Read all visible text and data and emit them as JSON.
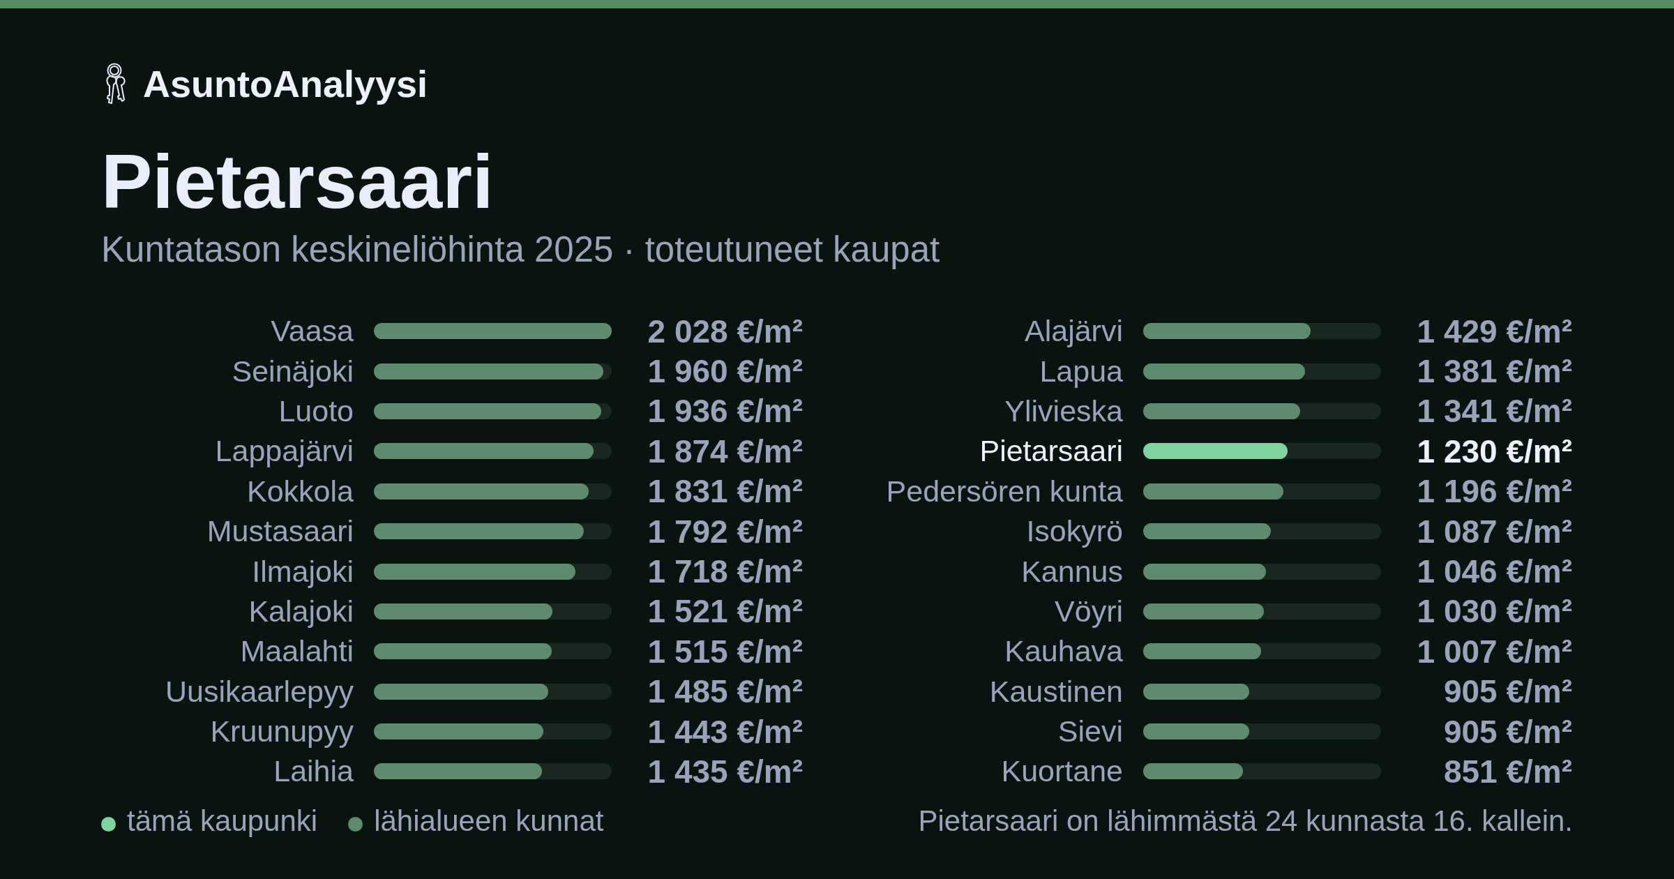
{
  "brand": {
    "name": "AsuntoAnalyysi"
  },
  "title": "Pietarsaari",
  "subtitle": "Kuntatason keskineliöhinta 2025 · toteutuneet kaupat",
  "municipalities": [
    {
      "name": "Vaasa",
      "price": "2 028 €/m²",
      "level": 1.0,
      "current": false
    },
    {
      "name": "Seinäjoki",
      "price": "1 960 €/m²",
      "level": 0.966,
      "current": false
    },
    {
      "name": "Luoto",
      "price": "1 936 €/m²",
      "level": 0.955,
      "current": false
    },
    {
      "name": "Lappajärvi",
      "price": "1 874 €/m²",
      "level": 0.924,
      "current": false
    },
    {
      "name": "Kokkola",
      "price": "1 831 €/m²",
      "level": 0.903,
      "current": false
    },
    {
      "name": "Mustasaari",
      "price": "1 792 €/m²",
      "level": 0.884,
      "current": false
    },
    {
      "name": "Ilmajoki",
      "price": "1 718 €/m²",
      "level": 0.847,
      "current": false
    },
    {
      "name": "Kalajoki",
      "price": "1 521 €/m²",
      "level": 0.75,
      "current": false
    },
    {
      "name": "Maalahti",
      "price": "1 515 €/m²",
      "level": 0.747,
      "current": false
    },
    {
      "name": "Uusikaarlepyy",
      "price": "1 485 €/m²",
      "level": 0.732,
      "current": false
    },
    {
      "name": "Kruunupyy",
      "price": "1 443 €/m²",
      "level": 0.712,
      "current": false
    },
    {
      "name": "Laihia",
      "price": "1 435 €/m²",
      "level": 0.708,
      "current": false
    },
    {
      "name": "Alajärvi",
      "price": "1 429 €/m²",
      "level": 0.705,
      "current": false
    },
    {
      "name": "Lapua",
      "price": "1 381 €/m²",
      "level": 0.681,
      "current": false
    },
    {
      "name": "Ylivieska",
      "price": "1 341 €/m²",
      "level": 0.661,
      "current": false
    },
    {
      "name": "Pietarsaari",
      "price": "1 230 €/m²",
      "level": 0.607,
      "current": true
    },
    {
      "name": "Pedersören kunta",
      "price": "1 196 €/m²",
      "level": 0.59,
      "current": false
    },
    {
      "name": "Isokyrö",
      "price": "1 087 €/m²",
      "level": 0.536,
      "current": false
    },
    {
      "name": "Kannus",
      "price": "1 046 €/m²",
      "level": 0.516,
      "current": false
    },
    {
      "name": "Vöyri",
      "price": "1 030 €/m²",
      "level": 0.508,
      "current": false
    },
    {
      "name": "Kauhava",
      "price": "1 007 €/m²",
      "level": 0.497,
      "current": false
    },
    {
      "name": "Kaustinen",
      "price": "905 €/m²",
      "level": 0.446,
      "current": false
    },
    {
      "name": "Sievi",
      "price": "905 €/m²",
      "level": 0.446,
      "current": false
    },
    {
      "name": "Kuortane",
      "price": "851 €/m²",
      "level": 0.42,
      "current": false
    }
  ],
  "legend": [
    {
      "label": "tämä kaupunki",
      "color": "#7fd3a0"
    },
    {
      "label": "lähialueen kunnat",
      "color": "#5e8a6d"
    }
  ],
  "summary": "Pietarsaari on lähimmästä 24 kunnasta 16. kallein."
}
